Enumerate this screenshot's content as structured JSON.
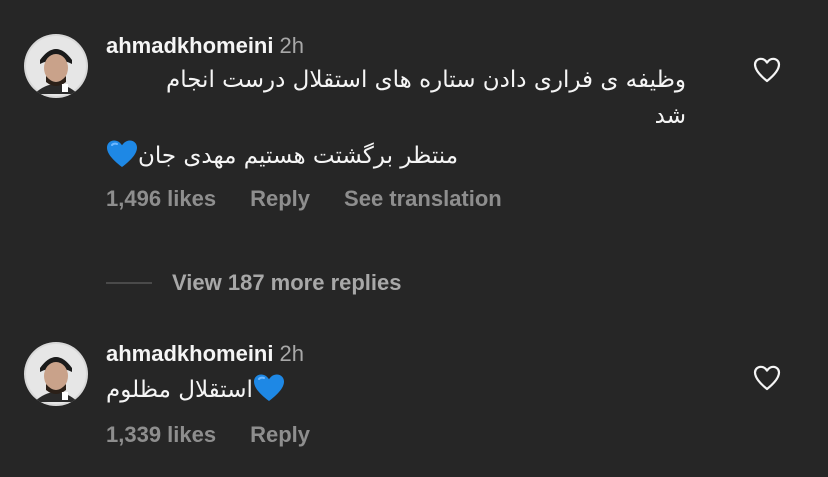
{
  "comments": [
    {
      "username": "ahmadkhomeini",
      "time": "2h",
      "text_lines": [
        "وظیفه ی فراری دادن ستاره های استقلال درست انجام",
        "شد",
        "منتظر برگشتت هستیم مهدی جان"
      ],
      "likes": "1,496 likes",
      "reply": "Reply",
      "translation": "See translation",
      "emoji": "blue-heart"
    },
    {
      "username": "ahmadkhomeini",
      "time": "2h",
      "text_lines": [
        "استقلال مظلوم"
      ],
      "likes": "1,339 likes",
      "reply": "Reply",
      "emoji": "blue-heart"
    }
  ],
  "view_replies": "View 187 more replies",
  "colors": {
    "background": "#262626",
    "text": "#f5f5f5",
    "secondary": "#8e8e8e",
    "heart_emoji": "#1e88e5"
  },
  "icons": {
    "like": "heart-outline-icon",
    "emoji": "blue-heart-emoji"
  }
}
